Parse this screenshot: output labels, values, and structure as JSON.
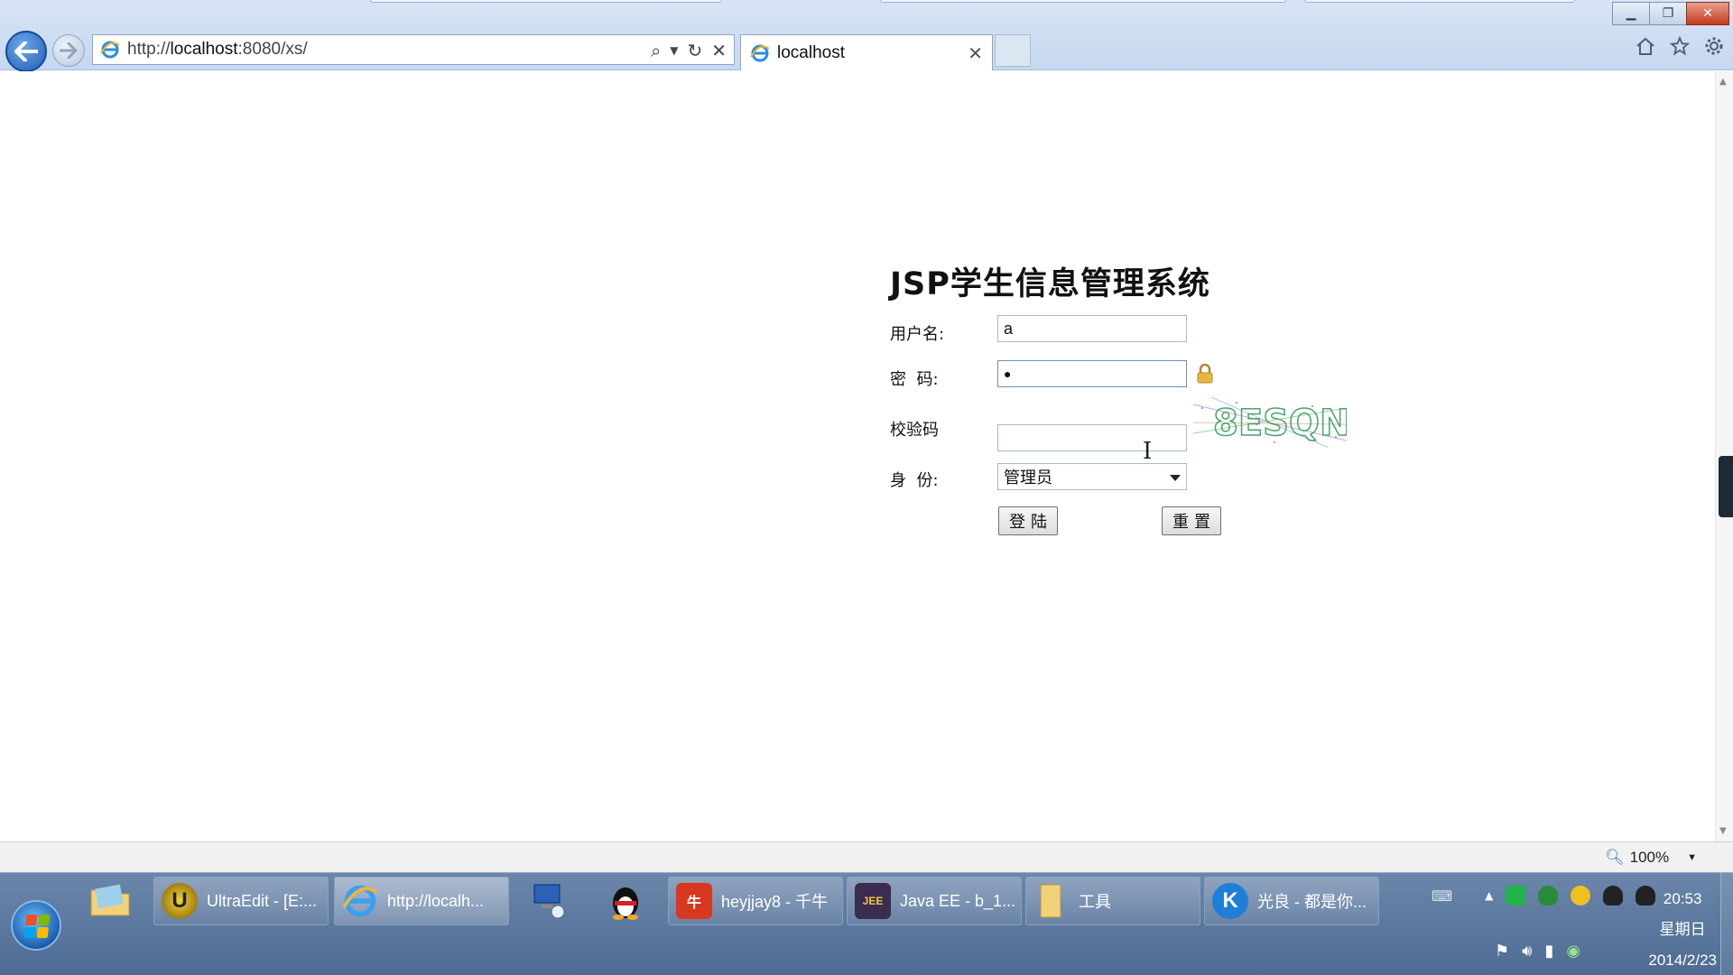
{
  "browser": {
    "address_url_prefix": "http://",
    "address_url_host": "localhost",
    "address_url_rest": ":8080/xs/",
    "tab_title": "localhost",
    "window_controls": [
      "minimize-icon",
      "restore-icon",
      "close-icon"
    ]
  },
  "page": {
    "title": "JSP学生信息管理系统",
    "form": {
      "username_label": "用户名:",
      "username_value": "a",
      "password_label": "密  码:",
      "password_value": "●",
      "captcha_label": "校验码",
      "captcha_value": "",
      "captcha_image_text": "8ESQN",
      "role_label": "身  份:",
      "role_selected": "管理员",
      "login_button": "登陆",
      "reset_button": "重置"
    }
  },
  "statusbar": {
    "zoom": "100%"
  },
  "taskbar": {
    "items": [
      {
        "label": "UltraEdit - [E:...",
        "icon": "ultraedit-icon"
      },
      {
        "label": "http://localh...",
        "icon": "ie-icon"
      },
      {
        "label": "heyjjay8 - 千牛",
        "icon": "qianniu-icon"
      },
      {
        "label": "Java EE - b_1...",
        "icon": "javaee-icon"
      },
      {
        "label": "工具",
        "icon": "folder-icon"
      },
      {
        "label": "光良 - 都是你...",
        "icon": "kugou-icon"
      }
    ],
    "clock_time": "20:53",
    "clock_day": "星期日",
    "clock_date": "2014/2/23"
  },
  "colors": {
    "chrome_bg": "#c6d8ef",
    "taskbar_bg": "#4e6b93",
    "close_red": "#c5391f"
  }
}
